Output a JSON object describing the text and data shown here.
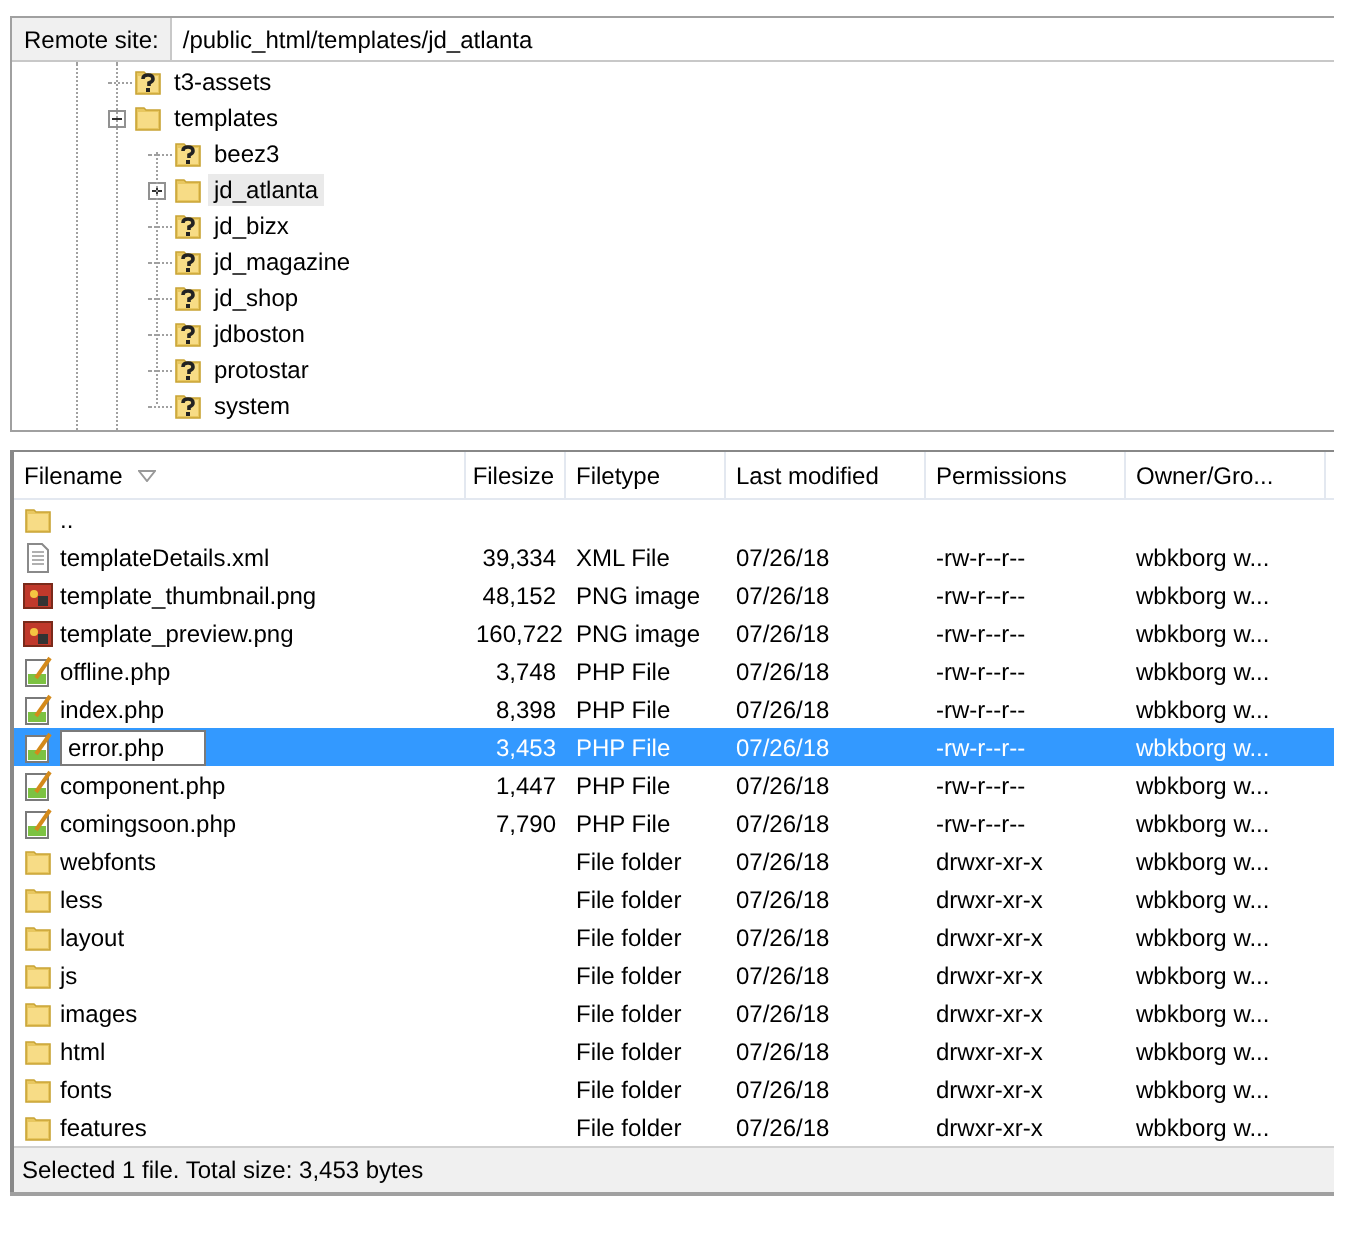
{
  "remote_site": {
    "label": "Remote site:",
    "path": "/public_html/templates/jd_atlanta"
  },
  "tree": [
    {
      "name": "t3-assets",
      "kind": "unknown",
      "selected": false
    },
    {
      "name": "templates",
      "kind": "folder",
      "expanded": true,
      "selected": false,
      "children": [
        {
          "name": "beez3",
          "kind": "unknown",
          "selected": false
        },
        {
          "name": "jd_atlanta",
          "kind": "folder",
          "expanded": false,
          "selected": true
        },
        {
          "name": "jd_bizx",
          "kind": "unknown",
          "selected": false
        },
        {
          "name": "jd_magazine",
          "kind": "unknown",
          "selected": false
        },
        {
          "name": "jd_shop",
          "kind": "unknown",
          "selected": false
        },
        {
          "name": "jdboston",
          "kind": "unknown",
          "selected": false
        },
        {
          "name": "protostar",
          "kind": "unknown",
          "selected": false
        },
        {
          "name": "system",
          "kind": "unknown",
          "selected": false
        }
      ]
    }
  ],
  "table": {
    "columns": [
      {
        "label": "Filename",
        "sorted": true
      },
      {
        "label": "Filesize",
        "sorted": false
      },
      {
        "label": "Filetype",
        "sorted": false
      },
      {
        "label": "Last modified",
        "sorted": false
      },
      {
        "label": "Permissions",
        "sorted": false
      },
      {
        "label": "Owner/Gro...",
        "sorted": false
      }
    ],
    "rows": [
      {
        "kind": "parent",
        "name": "..",
        "selected": false,
        "renaming": false
      },
      {
        "kind": "xml",
        "name": "templateDetails.xml",
        "size": "39,334",
        "type": "XML File",
        "modified": "07/26/18",
        "permissions": "-rw-r--r--",
        "owner": "wbkborg w...",
        "selected": false,
        "renaming": false
      },
      {
        "kind": "image",
        "name": "template_thumbnail.png",
        "size": "48,152",
        "type": "PNG image",
        "modified": "07/26/18",
        "permissions": "-rw-r--r--",
        "owner": "wbkborg w...",
        "selected": false,
        "renaming": false
      },
      {
        "kind": "image",
        "name": "template_preview.png",
        "size": "160,722",
        "type": "PNG image",
        "modified": "07/26/18",
        "permissions": "-rw-r--r--",
        "owner": "wbkborg w...",
        "selected": false,
        "renaming": false
      },
      {
        "kind": "php",
        "name": "offline.php",
        "size": "3,748",
        "type": "PHP File",
        "modified": "07/26/18",
        "permissions": "-rw-r--r--",
        "owner": "wbkborg w...",
        "selected": false,
        "renaming": false
      },
      {
        "kind": "php",
        "name": "index.php",
        "size": "8,398",
        "type": "PHP File",
        "modified": "07/26/18",
        "permissions": "-rw-r--r--",
        "owner": "wbkborg w...",
        "selected": false,
        "renaming": false
      },
      {
        "kind": "php",
        "name": "error.php",
        "size": "3,453",
        "type": "PHP File",
        "modified": "07/26/18",
        "permissions": "-rw-r--r--",
        "owner": "wbkborg w...",
        "selected": true,
        "renaming": true
      },
      {
        "kind": "php",
        "name": "component.php",
        "size": "1,447",
        "type": "PHP File",
        "modified": "07/26/18",
        "permissions": "-rw-r--r--",
        "owner": "wbkborg w...",
        "selected": false,
        "renaming": false
      },
      {
        "kind": "php",
        "name": "comingsoon.php",
        "size": "7,790",
        "type": "PHP File",
        "modified": "07/26/18",
        "permissions": "-rw-r--r--",
        "owner": "wbkborg w...",
        "selected": false,
        "renaming": false
      },
      {
        "kind": "folder",
        "name": "webfonts",
        "type": "File folder",
        "modified": "07/26/18",
        "permissions": "drwxr-xr-x",
        "owner": "wbkborg w...",
        "selected": false,
        "renaming": false
      },
      {
        "kind": "folder",
        "name": "less",
        "type": "File folder",
        "modified": "07/26/18",
        "permissions": "drwxr-xr-x",
        "owner": "wbkborg w...",
        "selected": false,
        "renaming": false
      },
      {
        "kind": "folder",
        "name": "layout",
        "type": "File folder",
        "modified": "07/26/18",
        "permissions": "drwxr-xr-x",
        "owner": "wbkborg w...",
        "selected": false,
        "renaming": false
      },
      {
        "kind": "folder",
        "name": "js",
        "type": "File folder",
        "modified": "07/26/18",
        "permissions": "drwxr-xr-x",
        "owner": "wbkborg w...",
        "selected": false,
        "renaming": false
      },
      {
        "kind": "folder",
        "name": "images",
        "type": "File folder",
        "modified": "07/26/18",
        "permissions": "drwxr-xr-x",
        "owner": "wbkborg w...",
        "selected": false,
        "renaming": false
      },
      {
        "kind": "folder",
        "name": "html",
        "type": "File folder",
        "modified": "07/26/18",
        "permissions": "drwxr-xr-x",
        "owner": "wbkborg w...",
        "selected": false,
        "renaming": false
      },
      {
        "kind": "folder",
        "name": "fonts",
        "type": "File folder",
        "modified": "07/26/18",
        "permissions": "drwxr-xr-x",
        "owner": "wbkborg w...",
        "selected": false,
        "renaming": false
      },
      {
        "kind": "folder",
        "name": "features",
        "type": "File folder",
        "modified": "07/26/18",
        "permissions": "drwxr-xr-x",
        "owner": "wbkborg w...",
        "selected": false,
        "renaming": false
      }
    ]
  },
  "status_bar": "Selected 1 file. Total size: 3,453 bytes"
}
